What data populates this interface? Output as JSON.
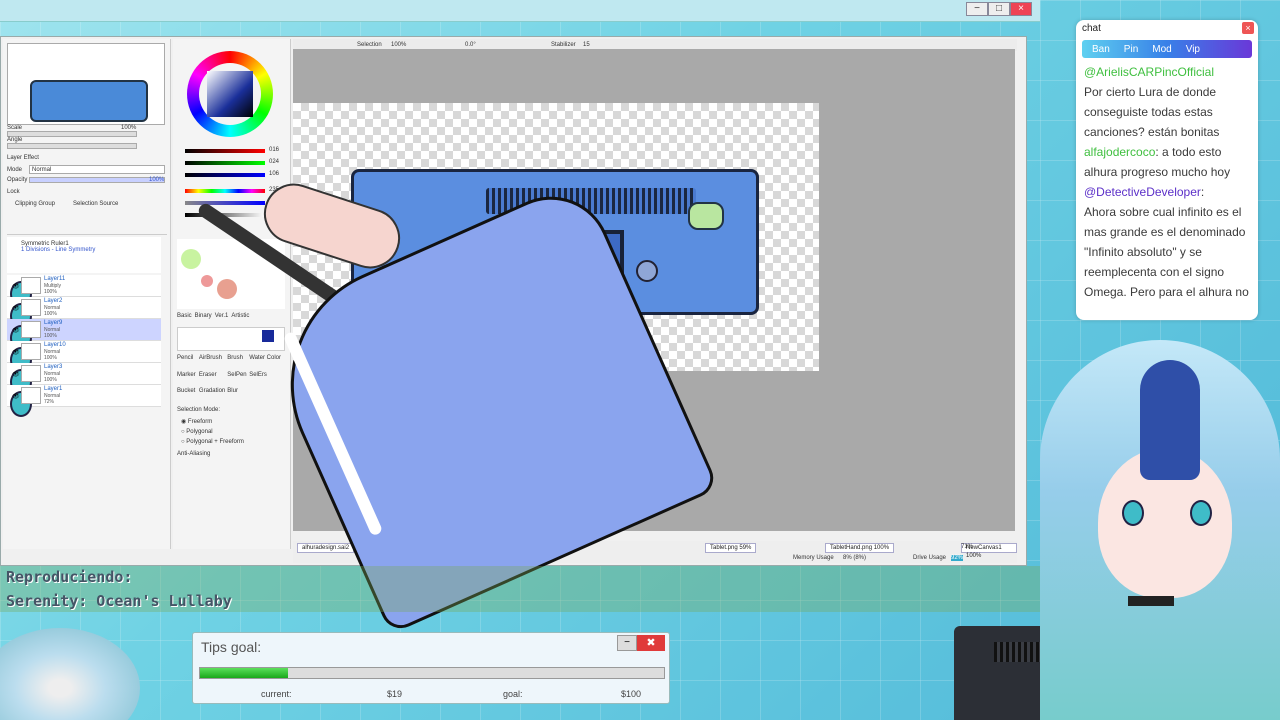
{
  "sai": {
    "scale_label": "Scale",
    "scale_value": "100%",
    "angle_label": "Angle",
    "layer_effect": "Layer Effect",
    "mode_label": "Mode",
    "mode_value": "Normal",
    "opacity_label": "Opacity",
    "opacity_value": "100%",
    "lock_label": "Lock",
    "clipping_group": "Clipping Group",
    "selection_source": "Selection Source",
    "ruler_name": "Symmetric Ruler1",
    "ruler_sub": "1 Divisions - Line Symmetry",
    "layers": [
      {
        "name": "Layer11",
        "mode": "Multiply",
        "opacity": "100%",
        "selected": false
      },
      {
        "name": "Layer2",
        "mode": "Normal",
        "opacity": "100%",
        "selected": false
      },
      {
        "name": "Layer9",
        "mode": "Normal",
        "opacity": "100%",
        "selected": true
      },
      {
        "name": "Layer10",
        "mode": "Normal",
        "opacity": "100%",
        "selected": false
      },
      {
        "name": "Layer3",
        "mode": "Normal",
        "opacity": "100%",
        "selected": false
      },
      {
        "name": "Layer1",
        "mode": "Normal",
        "opacity": "72%",
        "selected": false
      }
    ],
    "color_values": {
      "r": "016",
      "g": "024",
      "b": "106",
      "h": "235",
      "s": "085",
      "v": "041"
    },
    "tool_tabs": [
      "Basic",
      "Binary",
      "Ver.1",
      "Artistic"
    ],
    "tools": [
      "Pencil",
      "AirBrush",
      "Brush",
      "Water Color",
      "Marker",
      "Eraser",
      "SelPen",
      "SelErs",
      "Bucket",
      "Gradation",
      "Blur"
    ],
    "selection_mode_label": "Selection Mode:",
    "selection_modes": [
      "Freeform",
      "Polygonal",
      "Polygonal + Freeform"
    ],
    "anti_aliasing": "Anti-Aliasing",
    "toolbar": {
      "selection": "Selection",
      "zoom": "100%",
      "rotation": "0.0°",
      "stabilizer_label": "Stabilizer",
      "stabilizer_value": "15"
    },
    "tabs": [
      {
        "name": "alhuradesign.sai2",
        "zoom": ""
      },
      {
        "name": "Tablet.png",
        "zoom": "59%"
      },
      {
        "name": "TabletHand.png",
        "zoom": "100%"
      },
      {
        "name": "NewCanvas1",
        "zoom": "100%"
      }
    ],
    "last_tab_zoom": "71%",
    "memory_label": "Memory Usage",
    "memory_value": "8% (8%)",
    "drive_label": "Drive Usage",
    "drive_value": "92%"
  },
  "chat": {
    "title": "chat",
    "buttons": [
      "Ban",
      "Pin",
      "Mod",
      "Vip"
    ],
    "messages": [
      {
        "user": "@ArielisCARPincOfficial",
        "text": ""
      },
      {
        "user": "",
        "text": "Por cierto Lura de donde conseguiste todas estas canciones? están bonitas"
      },
      {
        "user": "alfajodercoco",
        "text": ": a todo esto alhura progreso mucho hoy"
      },
      {
        "user": "@DetectiveDeveloper",
        "text": ":"
      },
      {
        "user": "",
        "text": "Ahora sobre cual infinito es el mas grande es el denominado \"Infinito absoluto\" y se reemplecenta con el signo Omega. Pero para el alhura no"
      }
    ]
  },
  "now_playing": {
    "label": "Reproduciendo:",
    "song": "Serenity: Ocean's Lullaby"
  },
  "tips": {
    "title": "Tips goal:",
    "current_label": "current:",
    "current_value": "$19",
    "goal_label": "goal:",
    "goal_value": "$100",
    "progress": 0.19,
    "close_label": "✖",
    "min_label": "−"
  },
  "colors": {
    "accent": "#3880e8",
    "chat_user_green": "#3fbf3f",
    "chat_user_purple": "#5b2fc8",
    "tip_bar": "#1aa81a"
  }
}
